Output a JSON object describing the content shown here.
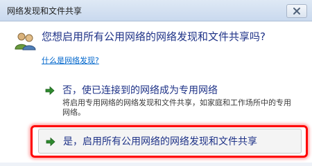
{
  "window": {
    "title": "网络发现和文件共享"
  },
  "dialog": {
    "heading": "您想启用所有公用网络的网络发现和文件共享吗?",
    "help_link": "什么是网络发现?",
    "options": [
      {
        "title": "否，使已连接到的网络成为专用网络",
        "description": "将启用专用网络的网络发现和文件共享，如家庭和工作场所中的专用网络。"
      },
      {
        "title": "是，启用所有公用网络的网络发现和文件共享",
        "description": ""
      }
    ]
  },
  "colors": {
    "title_blue": "#1e3287",
    "link_blue": "#0066cc",
    "arrow_green": "#2e8b2e",
    "highlight_red": "#ff0000"
  },
  "icons": {
    "dialog_icon": "users-icon",
    "close": "close-icon",
    "option_arrow": "green-arrow-icon"
  }
}
